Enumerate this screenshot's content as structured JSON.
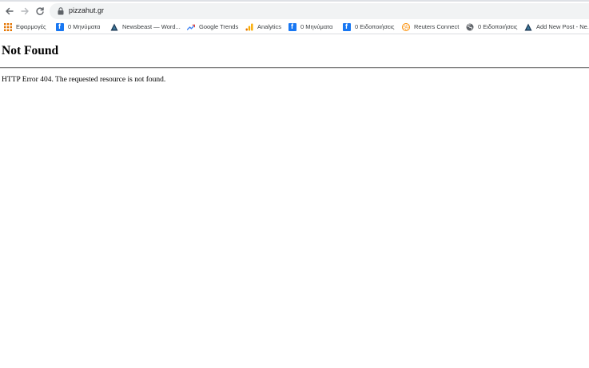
{
  "address_bar": {
    "url": "pizzahut.gr"
  },
  "bookmarks": [
    {
      "label": "Εφαρμογές",
      "icon": "apps-grid-icon"
    },
    {
      "label": "0 Μηνύματα",
      "icon": "facebook-icon"
    },
    {
      "label": "Newsbeast — Word...",
      "icon": "wordpress-icon"
    },
    {
      "label": "Google Trends",
      "icon": "trends-icon"
    },
    {
      "label": "Analytics",
      "icon": "analytics-icon"
    },
    {
      "label": "0 Μηνύματα",
      "icon": "facebook-icon"
    },
    {
      "label": "0 Ειδοποιήσεις",
      "icon": "facebook-icon"
    },
    {
      "label": "Reuters Connect",
      "icon": "reuters-icon"
    },
    {
      "label": "0 Ειδοποιήσεις",
      "icon": "globe-icon"
    },
    {
      "label": "Add New Post - Ne...",
      "icon": "wordpress-icon"
    }
  ],
  "page": {
    "title": "Not Found",
    "message": "HTTP Error 404. The requested resource is not found."
  },
  "colors": {
    "facebook": "#1877f2",
    "apps_grid": "#e37400",
    "trends": "#4285f4",
    "analytics": "#f9ab00",
    "reuters": "#fb8c00",
    "wordpress_dark": "#1d3b57"
  }
}
